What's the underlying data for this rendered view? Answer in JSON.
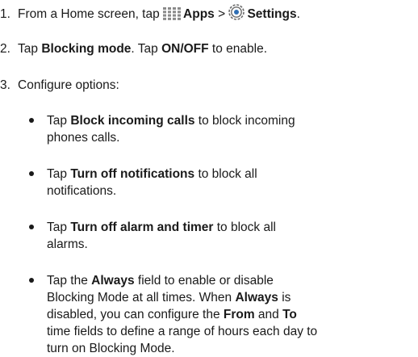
{
  "steps": [
    {
      "number": "1.",
      "pre": "From a Home screen, tap ",
      "bold1": "Apps",
      "sep": " > ",
      "bold2": "Settings",
      "post": ".",
      "icons": [
        "apps-grid-icon",
        "settings-gear-icon"
      ]
    },
    {
      "number": "2.",
      "t1": "Tap ",
      "b1": "Blocking mode",
      "t2": ". Tap ",
      "b2": "ON/OFF",
      "t3": " to enable."
    },
    {
      "number": "3.",
      "text": "Configure options:"
    }
  ],
  "options": [
    {
      "pre": "Tap ",
      "bold": "Block incoming calls",
      "post": " to block incoming",
      "line2": "phones calls."
    },
    {
      "pre": "Tap ",
      "bold": "Turn off notifications",
      "post": " to block all",
      "line2": "notifications."
    },
    {
      "pre": "Tap ",
      "bold": "Turn off alarm and timer",
      "post": " to block all",
      "line2": "alarms."
    },
    {
      "l1_pre": "Tap the ",
      "l1_bold": "Always",
      "l1_post": " field to enable or disable",
      "l2_pre": "Blocking Mode at all times. When ",
      "l2_bold": "Always",
      "l2_post": " is",
      "l3_pre": "disabled, you can configure the ",
      "l3_bold1": "From",
      "l3_mid": " and ",
      "l3_bold2": "To",
      "l4": "time fields to define a range of hours each day to",
      "l5": "turn on Blocking Mode."
    }
  ],
  "colors": {
    "text": "#1a1a1a",
    "icon_gray": "#8a8a8a",
    "gear_blue": "#2f6fb5"
  }
}
